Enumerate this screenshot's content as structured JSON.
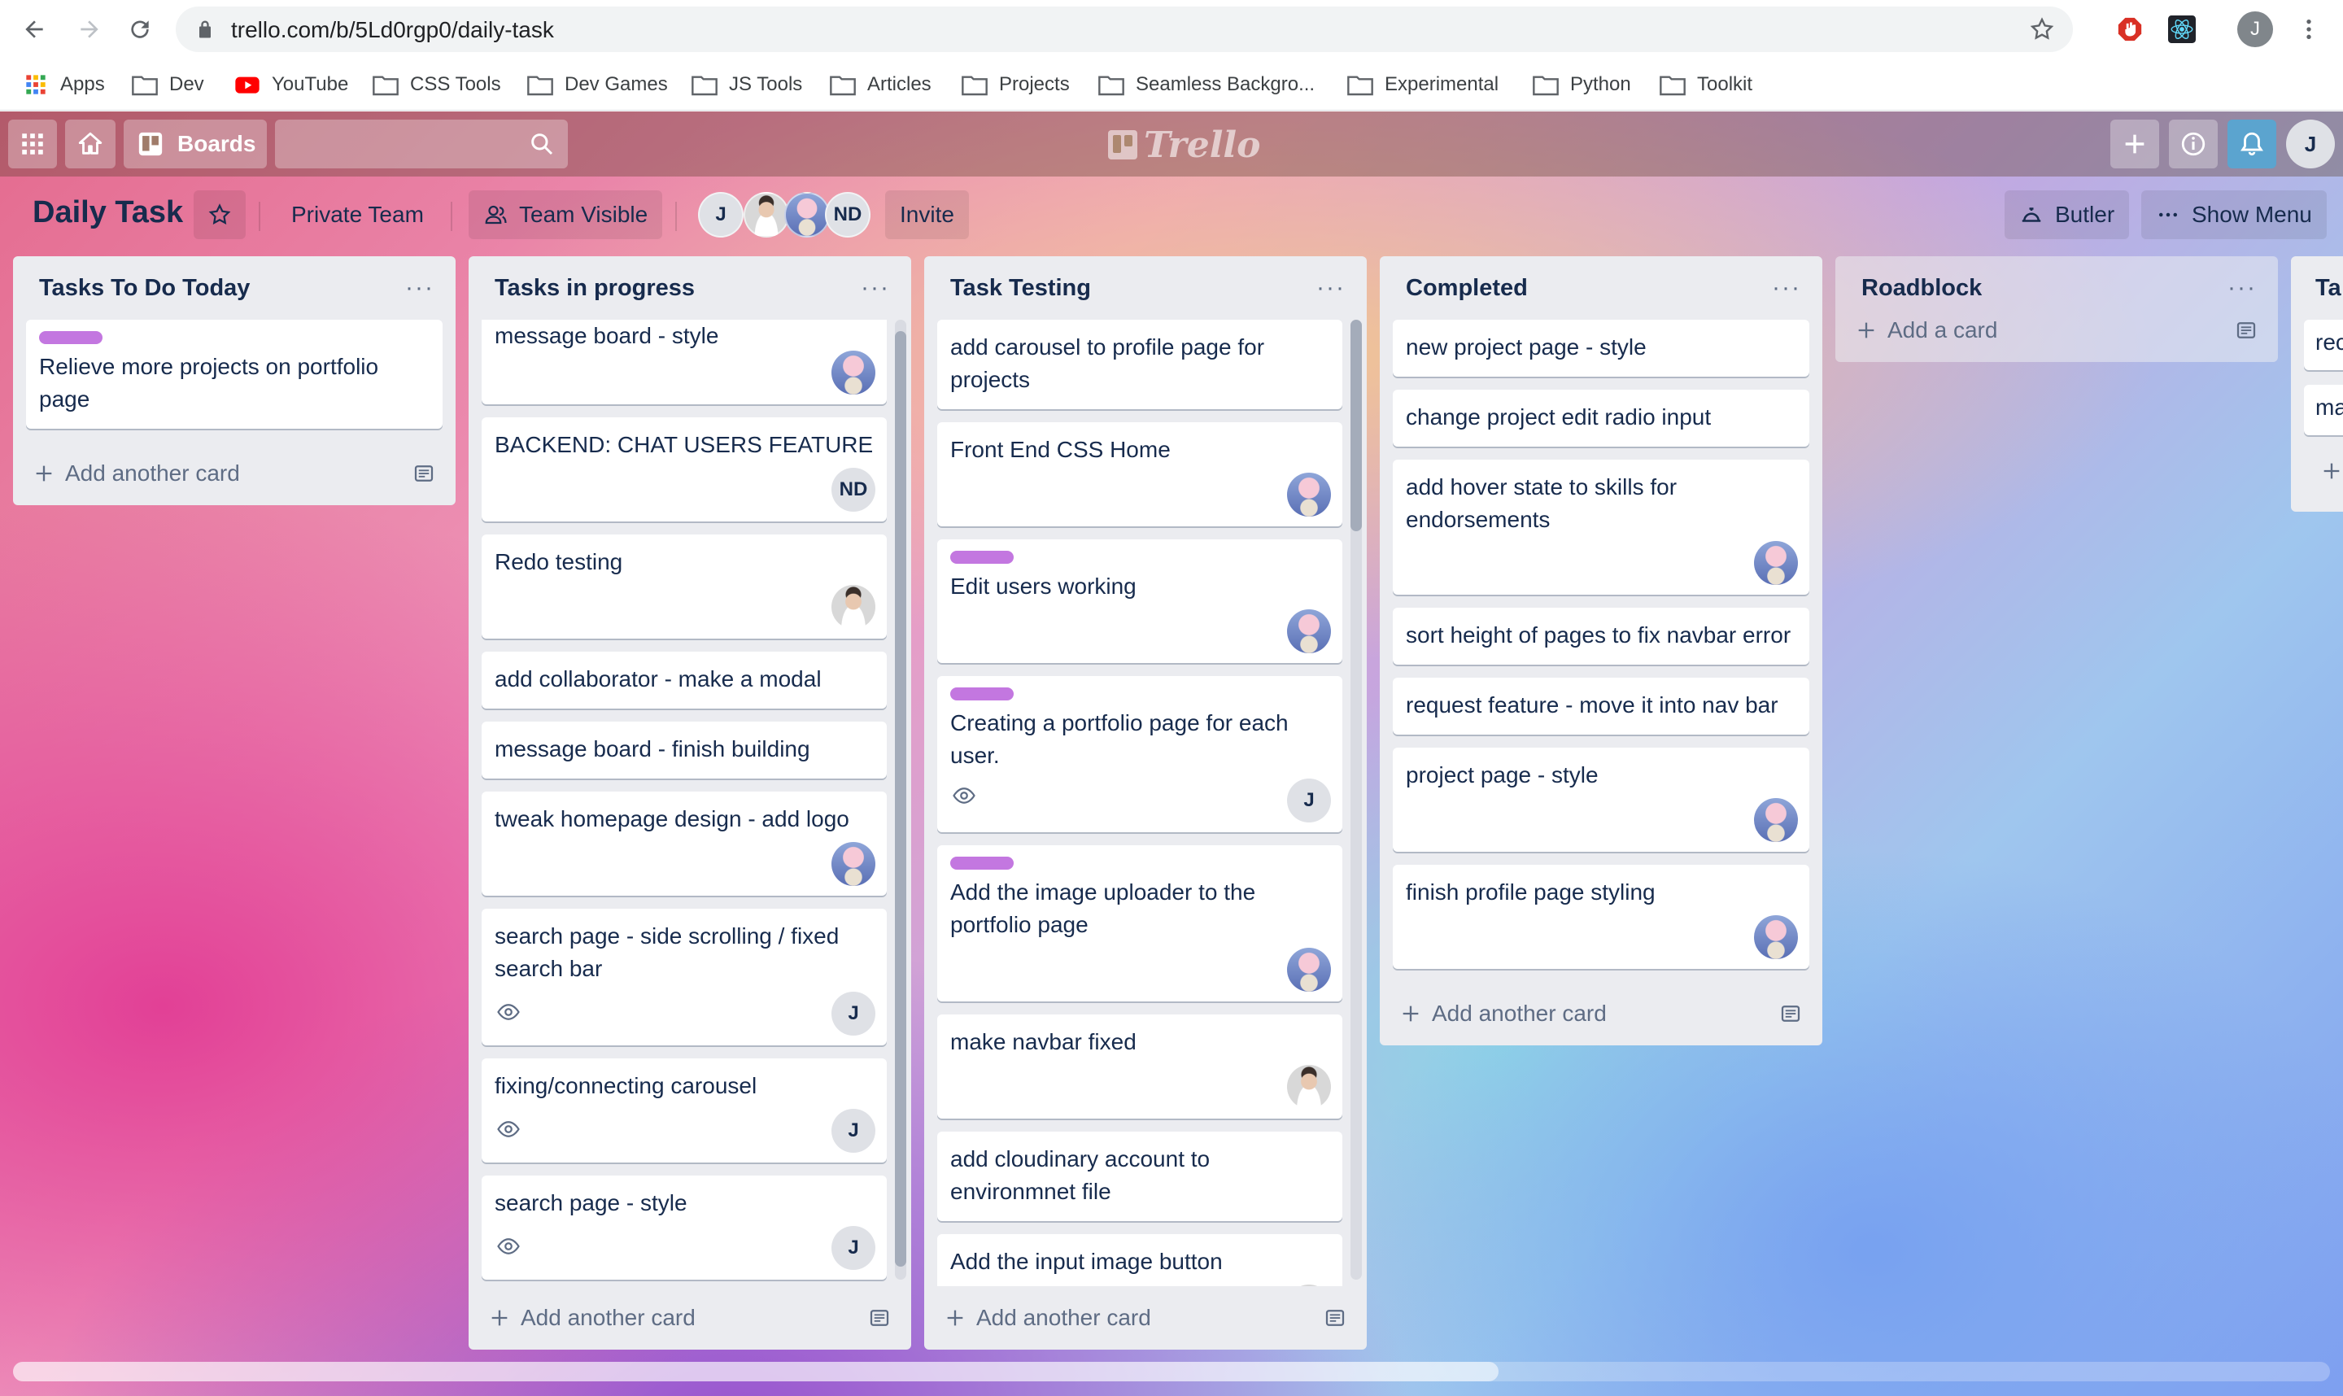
{
  "browser": {
    "url": "trello.com/b/5Ld0rgp0/daily-task",
    "profile_initial": "J",
    "bookmarks": [
      "Apps",
      "Dev",
      "YouTube",
      "CSS Tools",
      "Dev Games",
      "JS Tools",
      "Articles",
      "Projects",
      "Seamless Backgro...",
      "Experimental",
      "Python",
      "Toolkit"
    ]
  },
  "header": {
    "boards_label": "Boards",
    "logo_text": "Trello",
    "user_initial": "J"
  },
  "board": {
    "title": "Daily Task",
    "team_label": "Private Team",
    "visibility_label": "Team Visible",
    "members": [
      "J",
      "",
      "",
      "ND"
    ],
    "invite_label": "Invite",
    "butler_label": "Butler",
    "show_menu_label": "Show Menu"
  },
  "lists": [
    {
      "title": "Tasks To Do Today",
      "footer": "Add another card",
      "cards": [
        {
          "text": "Relieve more projects on portfolio page",
          "label": true,
          "avatar": null,
          "watch": false
        }
      ]
    },
    {
      "title": "Tasks in progress",
      "footer": "Add another card",
      "cards": [
        {
          "text": "message board - style",
          "label": false,
          "avatar": "mush",
          "watch": false
        },
        {
          "text": "BACKEND: CHAT USERS FEATURE",
          "label": false,
          "avatar": "ND",
          "watch": false
        },
        {
          "text": "Redo testing",
          "label": false,
          "avatar": "photo",
          "watch": false
        },
        {
          "text": "add collaborator - make a modal",
          "label": false,
          "avatar": null,
          "watch": false
        },
        {
          "text": "message board - finish building",
          "label": false,
          "avatar": null,
          "watch": false
        },
        {
          "text": "tweak homepage design - add logo",
          "label": false,
          "avatar": "mush",
          "watch": false
        },
        {
          "text": "search page - side scrolling / fixed search bar",
          "label": false,
          "avatar": "J",
          "watch": true
        },
        {
          "text": "fixing/connecting carousel",
          "label": false,
          "avatar": "J",
          "watch": true
        },
        {
          "text": "search page - style",
          "label": false,
          "avatar": "J",
          "watch": true
        }
      ]
    },
    {
      "title": "Task Testing",
      "footer": "Add another card",
      "cards": [
        {
          "text": "add carousel to profile page for projects",
          "label": false,
          "avatar": null,
          "watch": false
        },
        {
          "text": "Front End CSS Home",
          "label": false,
          "avatar": "mush",
          "watch": false
        },
        {
          "text": "Edit users working",
          "label": true,
          "avatar": "mush",
          "watch": false
        },
        {
          "text": "Creating a portfolio page for each user.",
          "label": true,
          "avatar": "J",
          "watch": true
        },
        {
          "text": "Add the image uploader to the portfolio page",
          "label": true,
          "avatar": "mush",
          "watch": false
        },
        {
          "text": "make navbar fixed",
          "label": false,
          "avatar": "photo",
          "watch": false
        },
        {
          "text": "add cloudinary account to environmnet file",
          "label": false,
          "avatar": null,
          "watch": false
        },
        {
          "text": "Add the input image button",
          "label": false,
          "avatar": "photo",
          "watch": false
        }
      ]
    },
    {
      "title": "Completed",
      "footer": "Add another card",
      "cards": [
        {
          "text": "new project page - style",
          "label": false,
          "avatar": null,
          "watch": false
        },
        {
          "text": "change project edit radio input",
          "label": false,
          "avatar": null,
          "watch": false
        },
        {
          "text": "add hover state to skills for endorsements",
          "label": false,
          "avatar": "mush",
          "watch": false
        },
        {
          "text": "sort height of pages to fix navbar error",
          "label": false,
          "avatar": null,
          "watch": false
        },
        {
          "text": "request feature - move it into nav bar",
          "label": false,
          "avatar": null,
          "watch": false
        },
        {
          "text": "project page - style",
          "label": false,
          "avatar": "mush",
          "watch": false
        },
        {
          "text": "finish profile page styling",
          "label": false,
          "avatar": "mush",
          "watch": false
        }
      ]
    },
    {
      "title": "Roadblock",
      "footer": "Add a card",
      "cards": []
    },
    {
      "title": "Ta",
      "footer": "",
      "cards": [
        {
          "text": "rec",
          "label": false,
          "avatar": null,
          "watch": false
        },
        {
          "text": "ma",
          "label": false,
          "avatar": null,
          "watch": false
        }
      ]
    }
  ]
}
